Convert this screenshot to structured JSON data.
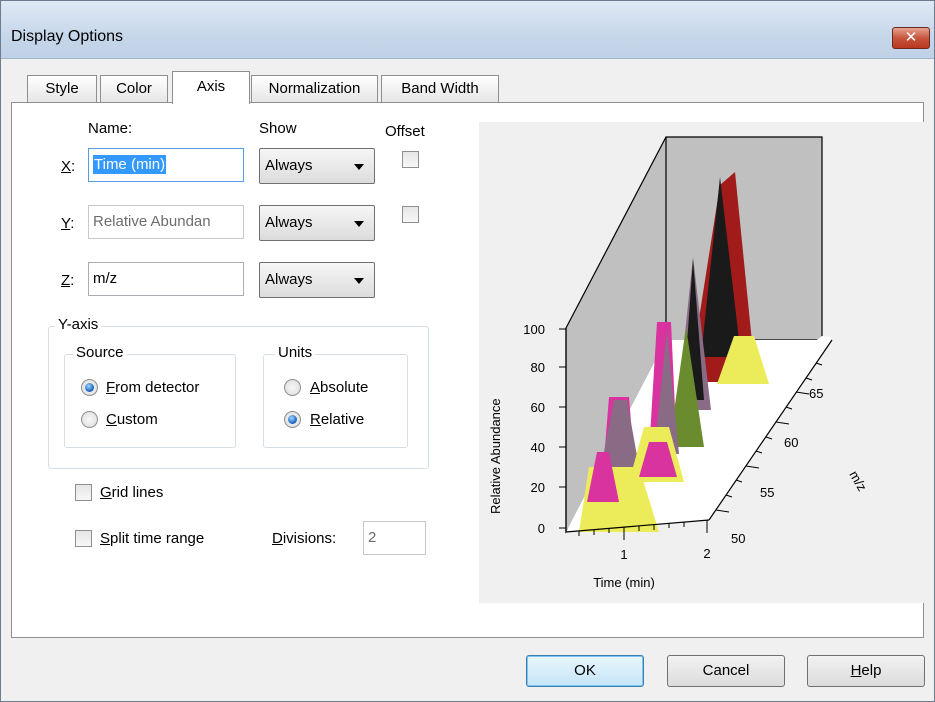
{
  "window": {
    "title": "Display Options",
    "close_icon": "close-icon"
  },
  "tabs": [
    {
      "label": "Style"
    },
    {
      "label": "Color"
    },
    {
      "label": "Axis"
    },
    {
      "label": "Normalization"
    },
    {
      "label": "Band Width"
    }
  ],
  "axis_table": {
    "headers": {
      "name": "Name:",
      "show": "Show",
      "offset": "Offset"
    },
    "rows": [
      {
        "axis": "X",
        "sep": ":",
        "name": "Time (min)",
        "show": "Always",
        "has_offset": true,
        "offset_checked": false,
        "name_selected": true
      },
      {
        "axis": "Y",
        "sep": ":",
        "name": "Relative Abundan",
        "show": "Always",
        "has_offset": true,
        "offset_checked": false,
        "name_disabled": true
      },
      {
        "axis": "Z",
        "sep": ":",
        "name": "m/z",
        "show": "Always",
        "has_offset": false
      }
    ]
  },
  "y_axis_group": {
    "title": "Y-axis",
    "source": {
      "title": "Source",
      "options": [
        {
          "mnemonic": "F",
          "rest": "rom detector",
          "selected": true
        },
        {
          "mnemonic": "C",
          "rest": "ustom",
          "selected": false
        }
      ]
    },
    "units": {
      "title": "Units",
      "options": [
        {
          "mnemonic": "A",
          "rest": "bsolute",
          "selected": false
        },
        {
          "mnemonic": "R",
          "rest": "elative",
          "selected": true
        }
      ]
    }
  },
  "options": {
    "grid_lines": {
      "mnemonic": "G",
      "rest": "rid lines",
      "checked": false
    },
    "split_time": {
      "mnemonic": "S",
      "rest": "plit time range",
      "checked": false
    },
    "divisions": {
      "mnemonic": "D",
      "rest": "ivisions:",
      "value": "2"
    }
  },
  "buttons": {
    "ok": "OK",
    "cancel": "Cancel",
    "help_mnemonic": "H",
    "help_rest": "elp"
  },
  "preview": {
    "y_label": "Relative Abundance",
    "x_label": "Time (min)",
    "z_label": "m/z",
    "y_ticks": [
      "0",
      "20",
      "40",
      "60",
      "80",
      "100"
    ],
    "x_ticks": [
      "1",
      "2"
    ],
    "z_ticks": [
      "50",
      "55",
      "60",
      "65"
    ],
    "colors": {
      "wall": "#c0c0c0",
      "yellow": "#ecec5a",
      "magenta": "#d8339f",
      "mauve": "#8a6b85",
      "green": "#6b8c2e",
      "black": "#1a1a1a",
      "red": "#a11b1b"
    }
  }
}
